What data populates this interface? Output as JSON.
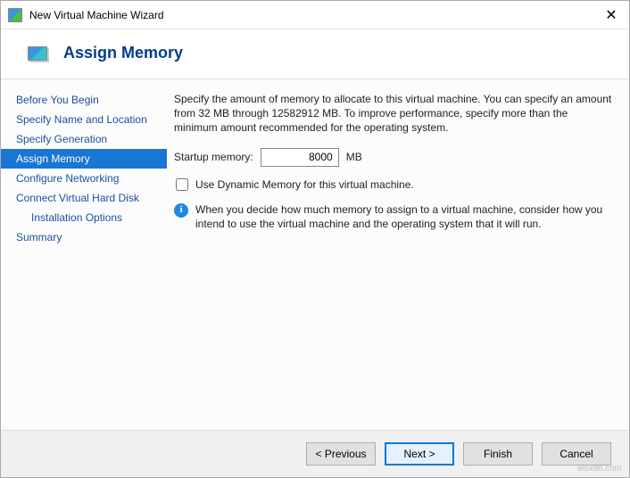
{
  "window": {
    "title": "New Virtual Machine Wizard",
    "close_glyph": "✕"
  },
  "header": {
    "title": "Assign Memory"
  },
  "sidebar": {
    "steps": [
      {
        "label": "Before You Begin"
      },
      {
        "label": "Specify Name and Location"
      },
      {
        "label": "Specify Generation"
      },
      {
        "label": "Assign Memory"
      },
      {
        "label": "Configure Networking"
      },
      {
        "label": "Connect Virtual Hard Disk"
      },
      {
        "label": "Installation Options"
      },
      {
        "label": "Summary"
      }
    ]
  },
  "content": {
    "description": "Specify the amount of memory to allocate to this virtual machine. You can specify an amount from 32 MB through 12582912 MB. To improve performance, specify more than the minimum amount recommended for the operating system.",
    "startup_label": "Startup memory:",
    "startup_value": "8000",
    "startup_unit": "MB",
    "dynamic_label": "Use Dynamic Memory for this virtual machine.",
    "info_glyph": "i",
    "info_text": "When you decide how much memory to assign to a virtual machine, consider how you intend to use the virtual machine and the operating system that it will run."
  },
  "footer": {
    "previous": "< Previous",
    "next": "Next >",
    "finish": "Finish",
    "cancel": "Cancel"
  },
  "watermark": "wsxdn.com"
}
